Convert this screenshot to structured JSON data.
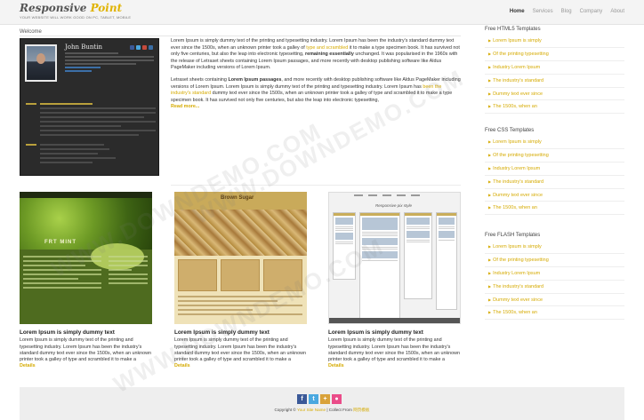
{
  "header": {
    "logo_part1": "Responsive",
    "logo_part2": "Point",
    "tagline": "YOUR WEBSITE WILL WORK GOOD ON PC, TABLET, MOBILE",
    "nav": [
      "Home",
      "Services",
      "Blog",
      "Company",
      "About"
    ],
    "active_nav": "Home"
  },
  "main": {
    "section_title": "Welcome",
    "profile_card": {
      "name": "John Buntin"
    },
    "intro": {
      "p1_a": "Lorem Ipsum is simply dummy text of the printing and typesetting industry. Lorem Ipsum has been the industry's standard dummy text ever since the 1500s, when an unknown printer took a galley of ",
      "p1_link": "type and scrambled",
      "p1_b": " it to make a type specimen book. It has survived not only five centuries, but also the leap into electronic typesetting, ",
      "p1_bold": "remaining essentially",
      "p1_c": " unchanged. It was popularised in the 1960s with the release of Letraset sheets containing Lorem Ipsum passages, and more recently with desktop publishing software like Aldus PageMaker including versions of Lorem Ipsum.",
      "p2_a": "Letraset sheets containing ",
      "p2_bold": "Lorem Ipsum passages",
      "p2_b": ", and more recently with desktop publishing software like Aldus PageMaker including versions of Lorem Ipsum. Lorem Ipsum is simply dummy text of the printing and typesetting industry. Lorem Ipsum has ",
      "p2_link": "been the industry's standard",
      "p2_c": " dummy text ever since the 1500s, when an unknown printer took a galley of type and scrambled it to make a type specimen book. It has survived not only five centuries, but also the leap into electronic typesetting,",
      "read_more": "Read more..."
    },
    "thumbnails": [
      {
        "title": "FRT MINT"
      },
      {
        "title": "Brown Sugar"
      },
      {
        "title": "Responsive pix style"
      }
    ],
    "captions": [
      {
        "heading": "Lorem Ipsum is simply dummy text",
        "body": "Lorem Ipsum is simply dummy text of the printing and typesetting industry. Lorem Ipsum has been the industry's standard dummy text ever since the 1500s, when an unknown printer took a galley of type and scrambled it to make a",
        "details": "Details"
      },
      {
        "heading": "Lorem Ipsum is simply dummy text",
        "body": "Lorem Ipsum is simply dummy text of the printing and typesetting industry. Lorem Ipsum has been the industry's standard dummy text ever since the 1500s, when an unknown printer took a galley of type and scrambled it to make a",
        "details": "Details"
      },
      {
        "heading": "Lorem Ipsum is simply dummy text",
        "body": "Lorem Ipsum is simply dummy text of the printing and typesetting industry. Lorem Ipsum has been the industry's standard dummy text ever since the 1500s, when an unknown printer took a galley of type and scrambled it to make a",
        "details": "Details"
      }
    ]
  },
  "sidebar": {
    "groups": [
      {
        "title": "Free HTML5 Templates",
        "items": [
          "Lorem Ipsum is simply",
          "Of the printing typesetting",
          "Industry Lorem Ipsum",
          "The industry's standard",
          "Dummy text ever since",
          "The 1500s, when an"
        ]
      },
      {
        "title": "Free CSS Templates",
        "items": [
          "Lorem Ipsum is simply",
          "Of the printing typesetting",
          "Industry Lorem Ipsum",
          "The industry's standard",
          "Dummy text ever since",
          "The 1500s, when an"
        ]
      },
      {
        "title": "Free FLASH Templates",
        "items": [
          "Lorem Ipsum is simply",
          "Of the printing typesetting",
          "Industry Lorem Ipsum",
          "The industry's standard",
          "Dummy text ever since",
          "The 1500s, when an"
        ]
      }
    ]
  },
  "footer": {
    "copyright_prefix": "Copyright ©",
    "copyright_link": "Your Site Name",
    "collect_prefix": "| Collect From",
    "collect_link": "网页模板",
    "social": [
      {
        "name": "facebook-icon",
        "glyph": "f",
        "color": "#3b5998"
      },
      {
        "name": "twitter-icon",
        "glyph": "t",
        "color": "#4aa8e0"
      },
      {
        "name": "googleplus-icon",
        "glyph": "+",
        "color": "#d9a23a"
      },
      {
        "name": "dribbble-icon",
        "glyph": "●",
        "color": "#ea4c89"
      }
    ]
  },
  "watermark": "WWW.DOWNDEMO.COM",
  "colors": {
    "accent": "#d5aa00",
    "text": "#333333",
    "footer_bg": "#eeeeee"
  }
}
